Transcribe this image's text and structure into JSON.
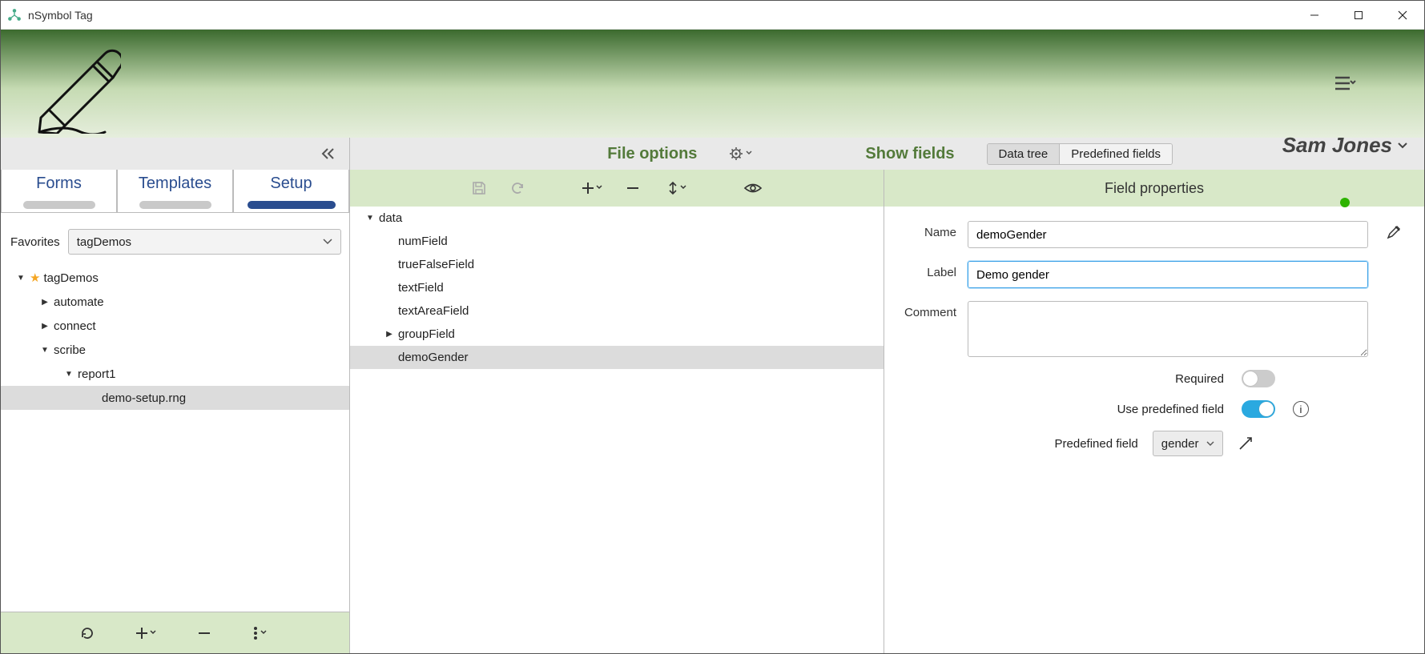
{
  "window": {
    "title": "nSymbol Tag"
  },
  "header": {
    "user": "Sam Jones"
  },
  "sidebar": {
    "tabs": [
      "Forms",
      "Templates",
      "Setup"
    ],
    "active_tab": 2,
    "favorites_label": "Favorites",
    "favorites_selected": "tagDemos",
    "tree": [
      {
        "label": "tagDemos",
        "depth": 0,
        "caret": "down",
        "star": true
      },
      {
        "label": "automate",
        "depth": 1,
        "caret": "right"
      },
      {
        "label": "connect",
        "depth": 1,
        "caret": "right"
      },
      {
        "label": "scribe",
        "depth": 1,
        "caret": "down"
      },
      {
        "label": "report1",
        "depth": 2,
        "caret": "down"
      },
      {
        "label": "demo-setup.rng",
        "depth": 3,
        "caret": "",
        "selected": true
      }
    ]
  },
  "main_header": {
    "file_options": "File options",
    "show_fields": "Show fields",
    "segments": [
      "Data tree",
      "Predefined fields"
    ],
    "active_segment": 0
  },
  "center_tree": [
    {
      "label": "data",
      "depth": 0,
      "caret": "down"
    },
    {
      "label": "numField",
      "depth": 1,
      "caret": ""
    },
    {
      "label": "trueFalseField",
      "depth": 1,
      "caret": ""
    },
    {
      "label": "textField",
      "depth": 1,
      "caret": ""
    },
    {
      "label": "textAreaField",
      "depth": 1,
      "caret": ""
    },
    {
      "label": "groupField",
      "depth": 1,
      "caret": "right"
    },
    {
      "label": "demoGender",
      "depth": 1,
      "caret": "",
      "selected": true
    }
  ],
  "props": {
    "title": "Field properties",
    "name_label": "Name",
    "name_value": "demoGender",
    "label_label": "Label",
    "label_value": "Demo gender",
    "comment_label": "Comment",
    "comment_value": "",
    "required_label": "Required",
    "required_on": false,
    "predef_toggle_label": "Use predefined field",
    "predef_toggle_on": true,
    "predef_label": "Predefined field",
    "predef_value": "gender"
  }
}
